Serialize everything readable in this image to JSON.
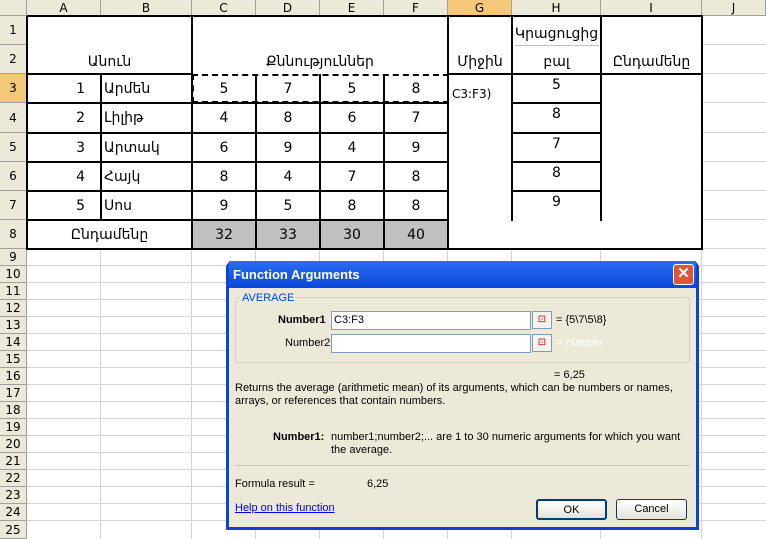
{
  "columns": [
    "A",
    "B",
    "C",
    "D",
    "E",
    "F",
    "G",
    "H",
    "I",
    "J"
  ],
  "rows": [
    "1",
    "2",
    "3",
    "4",
    "5",
    "6",
    "7",
    "8",
    "9",
    "10",
    "11",
    "12",
    "13",
    "14",
    "15",
    "16",
    "17",
    "18",
    "19",
    "20",
    "21",
    "22",
    "23",
    "24",
    "25"
  ],
  "table": {
    "header_name": "Անուն",
    "header_grades": "Քննություններ",
    "header_avg": "Միջին",
    "header_top_line1": "Կրացուցից",
    "header_top_line2": "բալ",
    "header_total": "Ընդամենը",
    "students": [
      {
        "n": "1",
        "name": "Արմեն",
        "c": "5",
        "d": "7",
        "e": "5",
        "f": "8",
        "h": "5"
      },
      {
        "n": "2",
        "name": "Լիլիթ",
        "c": "4",
        "d": "8",
        "e": "6",
        "f": "7",
        "h": "8"
      },
      {
        "n": "3",
        "name": "Արտակ",
        "c": "6",
        "d": "9",
        "e": "4",
        "f": "9",
        "h": "7"
      },
      {
        "n": "4",
        "name": "Հայկ",
        "c": "8",
        "d": "4",
        "e": "7",
        "f": "8",
        "h": "8"
      },
      {
        "n": "5",
        "name": "Սոս",
        "c": "9",
        "d": "5",
        "e": "8",
        "f": "8",
        "h": "9"
      }
    ],
    "total_label": "Ընդամենը",
    "totals": [
      "32",
      "33",
      "30",
      "40"
    ],
    "edit_cell": "C3:F3)"
  },
  "dialog": {
    "title": "Function Arguments",
    "close": "✕",
    "function_name": "AVERAGE",
    "number1_label": "Number1",
    "number1_value": "C3:F3",
    "number1_result": "= {5\\7\\5\\8}",
    "number2_label": "Number2",
    "number2_result": "= number",
    "ref_icon": "⊡",
    "result_inline": "= 6,25",
    "description": "Returns the average (arithmetic mean) of its arguments, which can be numbers or names, arrays, or references that contain numbers.",
    "arg_label": "Number1:",
    "arg_desc": "number1;number2;... are 1 to 30 numeric arguments for which you want the average.",
    "formula_result_label": "Formula result =",
    "formula_result_value": "6,25",
    "help_link": "Help on this function",
    "ok": "OK",
    "cancel": "Cancel"
  }
}
